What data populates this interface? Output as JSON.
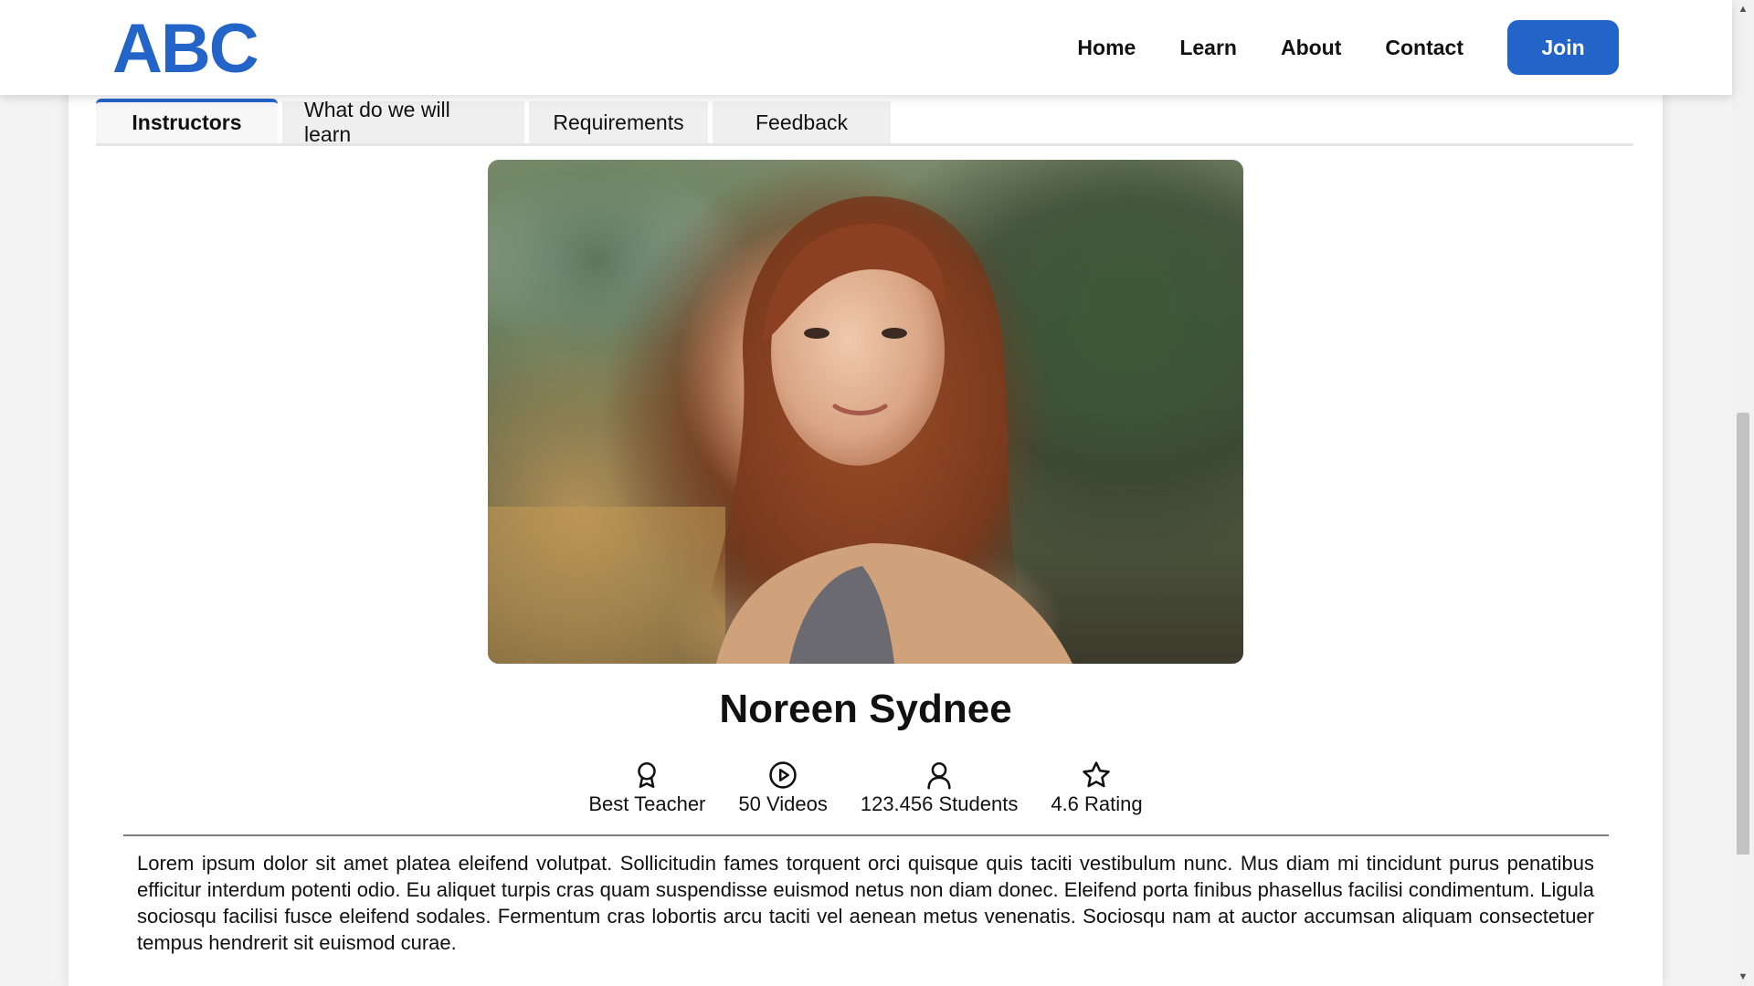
{
  "header": {
    "logo": "ABC",
    "nav": [
      "Home",
      "Learn",
      "About",
      "Contact"
    ],
    "join_label": "Join"
  },
  "tabs": [
    {
      "label": "Instructors",
      "active": true
    },
    {
      "label": "What do we will learn",
      "active": false
    },
    {
      "label": "Requirements",
      "active": false
    },
    {
      "label": "Feedback",
      "active": false
    }
  ],
  "instructor": {
    "name": "Noreen Sydnee",
    "stats": [
      {
        "icon": "award-icon",
        "label": "Best Teacher"
      },
      {
        "icon": "play-circle-icon",
        "label": "50 Videos"
      },
      {
        "icon": "user-icon",
        "label": "123.456 Students"
      },
      {
        "icon": "star-icon",
        "label": "4.6 Rating"
      }
    ],
    "bio": "Lorem ipsum dolor sit amet platea eleifend volutpat. Sollicitudin fames torquent orci quisque quis taciti vestibulum nunc. Mus diam mi tincidunt purus penatibus efficitur interdum potenti odio. Eu aliquet turpis cras quam suspendisse euismod netus non diam donec. Eleifend porta finibus phasellus facilisi condimentum. Ligula sociosqu facilisi fusce eleifend sodales. Fermentum cras lobortis arcu taciti vel aenean metus venenatis. Sociosqu nam at auctor accumsan aliquam consectetuer tempus hendrerit sit euismod curae."
  },
  "colors": {
    "accent": "#2364c9",
    "tab_bg": "#efefef",
    "text": "#111111"
  }
}
